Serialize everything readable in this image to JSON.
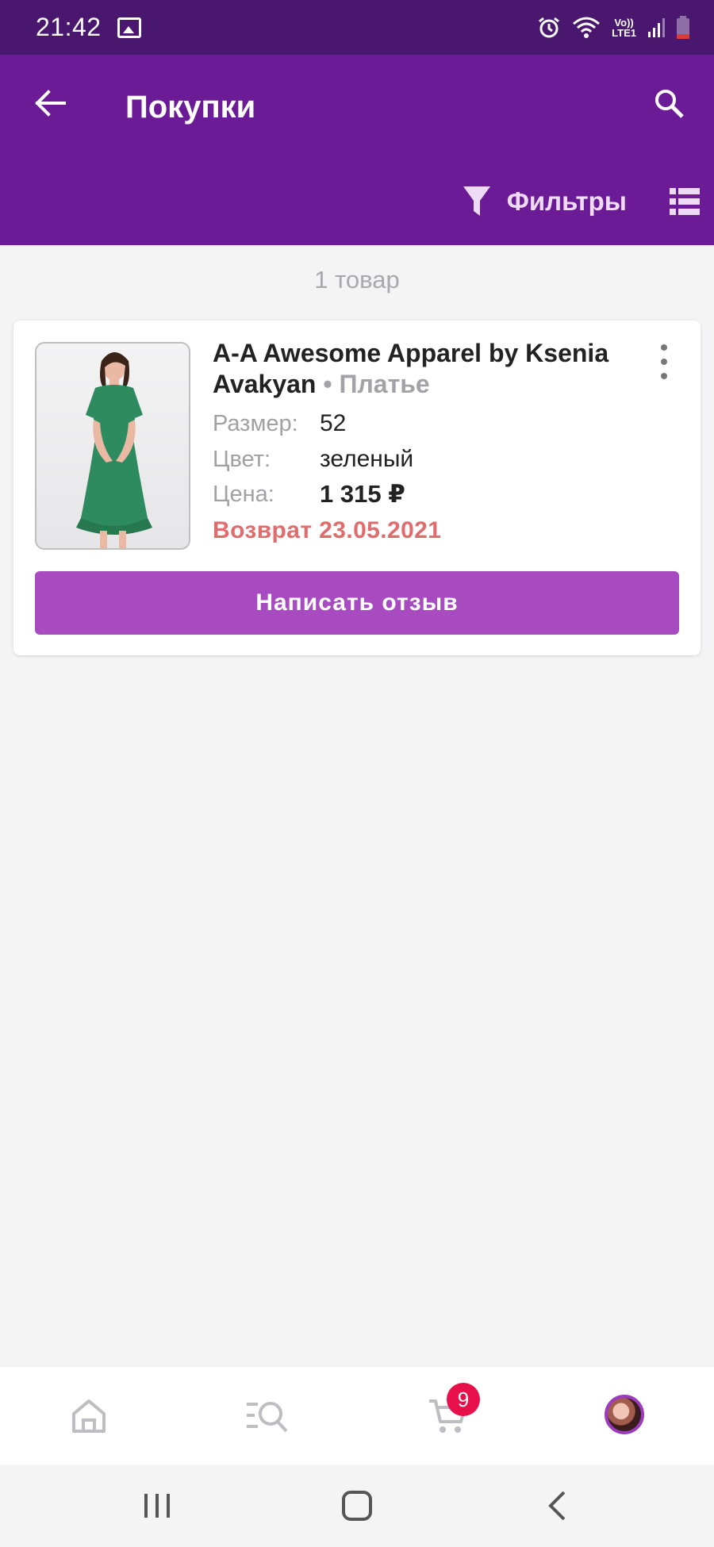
{
  "status_bar": {
    "time": "21:42",
    "icons": [
      "image-icon",
      "alarm-icon",
      "wifi-icon",
      "volte-icon",
      "signal-icon",
      "battery-icon"
    ],
    "volte_text": "Vo))",
    "lte_text": "LTE1"
  },
  "header": {
    "title": "Покупки",
    "filters_label": "Фильтры",
    "colors": {
      "status_bar": "#4a176e",
      "app_bar": "#6c1b97"
    }
  },
  "list": {
    "count_text": "1 товар"
  },
  "product": {
    "brand": "A-A Awesome Apparel by Ksenia Avakyan",
    "type": "• Платье",
    "size_label": "Размер:",
    "size_value": "52",
    "color_label": "Цвет:",
    "color_value": "зеленый",
    "price_label": "Цена:",
    "price_value": "1 315 ₽",
    "return_text": "Возврат 23.05.2021",
    "review_button": "Написать отзыв",
    "colors": {
      "return": "#e06d6d",
      "button": "#a84bc0",
      "dress": "#2e8a5f"
    }
  },
  "bottom_nav": {
    "items": [
      "home-icon",
      "catalog-search-icon",
      "cart-icon",
      "profile-avatar"
    ],
    "cart_badge": "9"
  }
}
